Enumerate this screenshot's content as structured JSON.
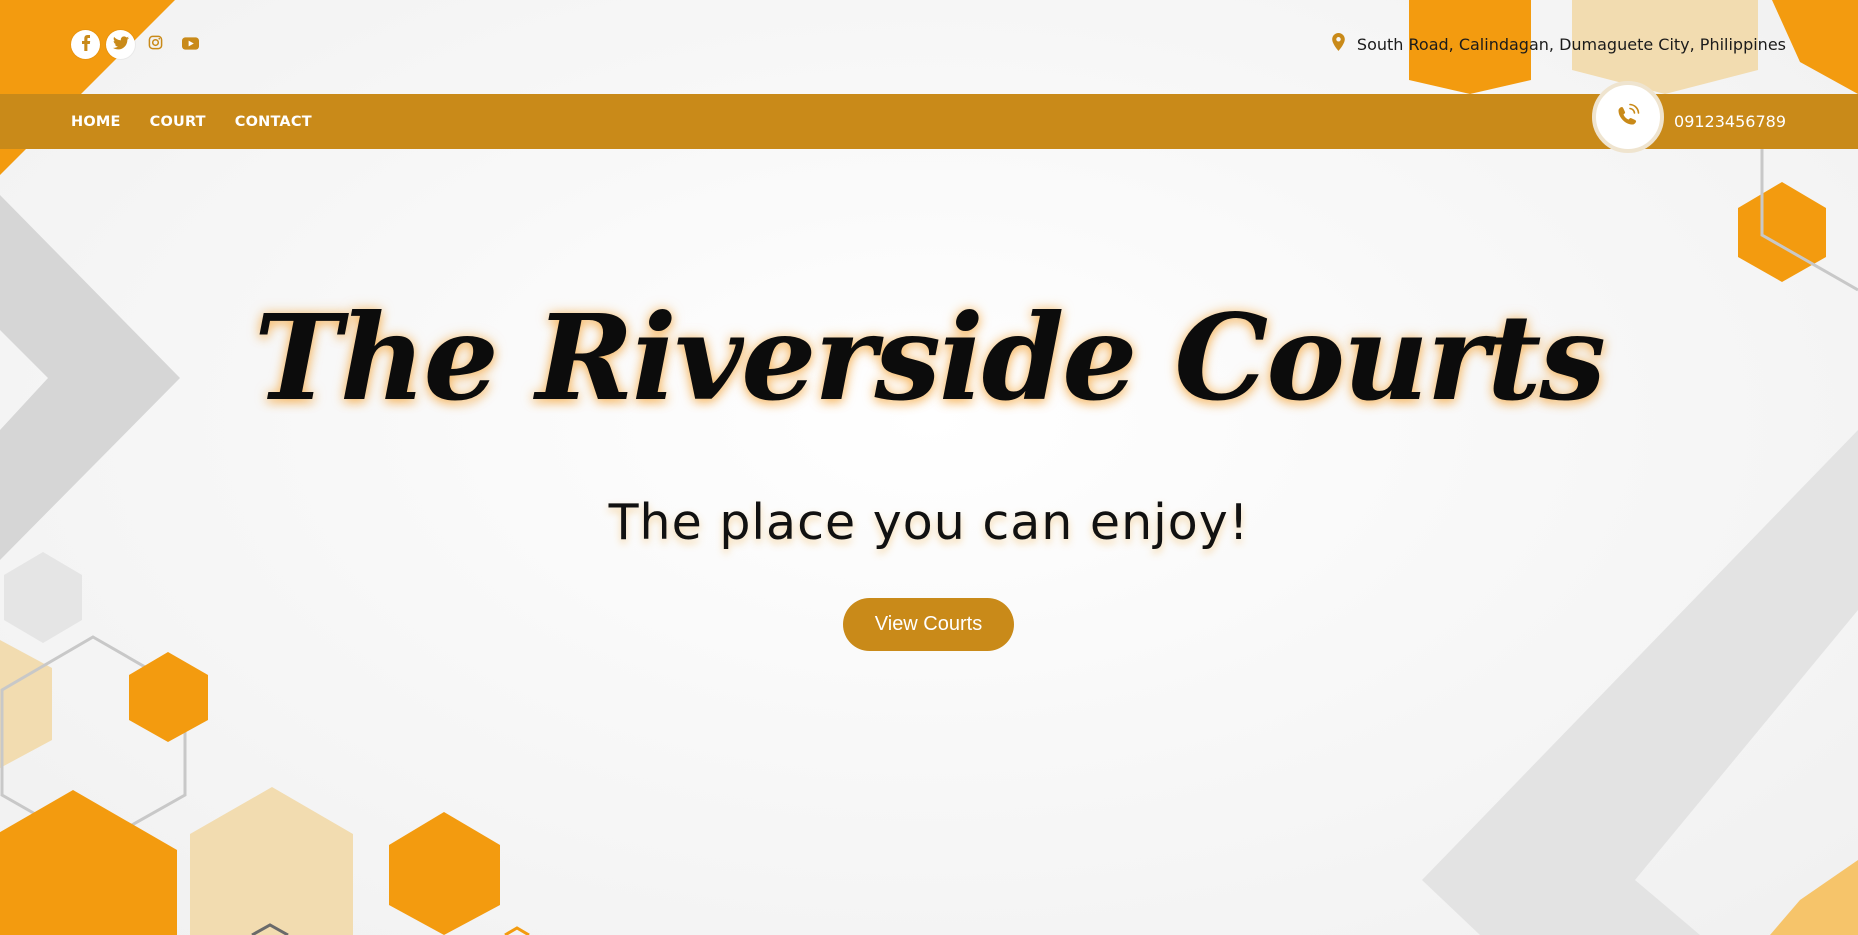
{
  "colors": {
    "brand": "#c98a19",
    "accent_orange": "#f39b0f",
    "light_tan": "#f2dcb0",
    "gray_shape": "#d9d9d9"
  },
  "topbar": {
    "socials": [
      {
        "name": "facebook",
        "icon": "facebook-icon"
      },
      {
        "name": "twitter",
        "icon": "twitter-icon"
      },
      {
        "name": "instagram",
        "icon": "instagram-icon"
      },
      {
        "name": "youtube",
        "icon": "youtube-icon"
      }
    ],
    "address_icon": "map-pin-icon",
    "address": "South Road, Calindagan, Dumaguete City, Philippines"
  },
  "navbar": {
    "items": [
      "HOME",
      "COURT",
      "CONTACT"
    ],
    "phone_icon": "phone-icon",
    "phone": "09123456789"
  },
  "hero": {
    "title": "The Riverside Courts",
    "subtitle": "The place you can enjoy!",
    "cta_label": "View Courts"
  }
}
